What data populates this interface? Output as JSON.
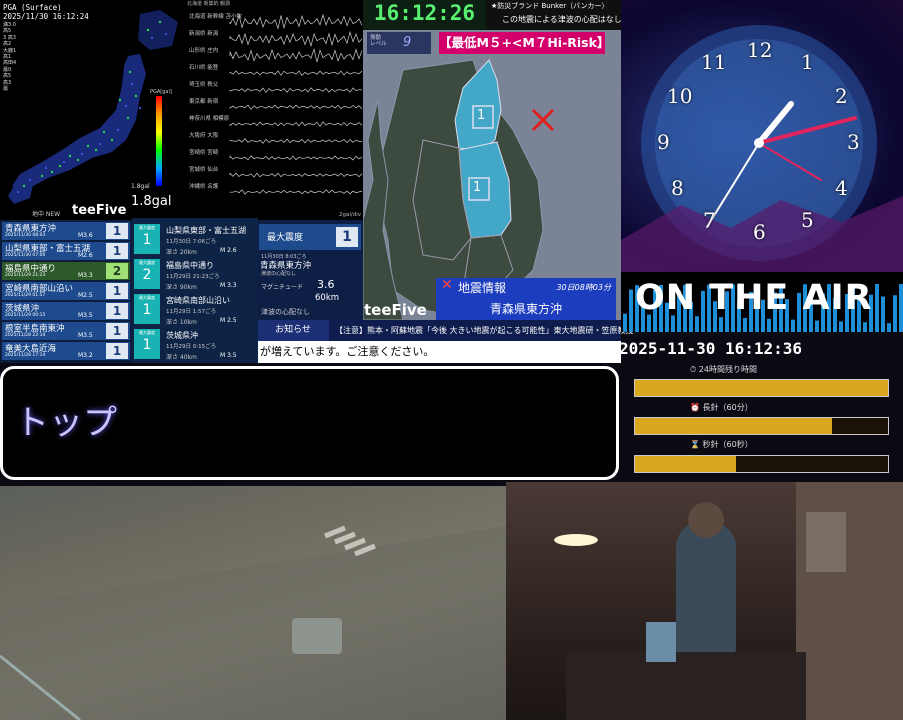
{
  "map_panel": {
    "title": "PGA (Surface)",
    "timestamp": "2025/11/30 16:12:24",
    "scale_labels": [
      "満3.0",
      "高5",
      "3 高3",
      "高2",
      "大鹿1",
      "高1",
      "高田4",
      "最0",
      "高5",
      "高3",
      "最"
    ],
    "unit_label": "PGA[gal]",
    "tick_labels": [
      "",
      "",
      "",
      "",
      "",
      "",
      "",
      ""
    ],
    "gal_small": "1.8gal",
    "gal_big": "1.8gal"
  },
  "wave_panel": {
    "header": "北海道 新築的 観測",
    "stations": [
      "北海道 新幹線 苫小牧",
      "新潟県 新潟",
      "山形県 庄内",
      "石川県 能登",
      "埼玉県 秩父",
      "東京都 新宿",
      "神奈川県 相模原",
      "大阪府 大阪",
      "宮崎県 宮崎",
      "宮城県 仙台",
      "沖縄県 名護"
    ],
    "footer": "2gal/div"
  },
  "clock_bar": {
    "time": "16:12:26"
  },
  "bunker": {
    "line1": "★防災ブランド Bunker（バンカー）",
    "line2": "この地震による津波の心配はなし"
  },
  "tohoku": {
    "level_label": "振動\nレベル",
    "level_value": "9",
    "risk_banner": "【最低M５+<M７Hi-Risk】",
    "intensity_top": "1",
    "intensity_mid": "1",
    "logo": "teeFive"
  },
  "quake_info": {
    "title": "地震情報",
    "time": "30日08時03分",
    "region": "青森県東方沖"
  },
  "notice": {
    "label": "お知らせ",
    "text": "【注意】熊本・阿蘇地震「今後 大きい地震が起こる可能性」東大地震研・笠原教授",
    "continued": "が増えています。ご注意ください。"
  },
  "quake_list": {
    "header": "地中 NEW",
    "logo": "teeFive",
    "rows": [
      {
        "name": "青森県東方沖",
        "date": "2025/11/30 08:03",
        "mag": "M3.6",
        "int": "1",
        "hl": false
      },
      {
        "name": "山梨県東部・富士五湖",
        "date": "2025/11/30 07:00",
        "mag": "M2.6",
        "int": "1",
        "hl": false
      },
      {
        "name": "福島県中通り",
        "date": "2025/11/29 21:23",
        "mag": "M3.3",
        "int": "2",
        "hl": true
      },
      {
        "name": "宮崎県南部山沿い",
        "date": "2025/11/29 01:57",
        "mag": "M2.5",
        "int": "1",
        "hl": false
      },
      {
        "name": "茨城県沖",
        "date": "2025/11/29 00:15",
        "mag": "M3.5",
        "int": "1",
        "hl": false
      },
      {
        "name": "根室半島南東沖",
        "date": "2025/11/28 22:14",
        "mag": "M3.5",
        "int": "1",
        "hl": false
      },
      {
        "name": "奄美大島近海",
        "date": "2025/11/28 17:14",
        "mag": "M3.2",
        "int": "1",
        "hl": false
      }
    ]
  },
  "detail_list": {
    "int_label": "最大震度",
    "rows": [
      {
        "name": "山梨県東部・富士五湖",
        "date": "11月30日 7:06ごろ",
        "depth": "深さ 20km",
        "mag": "M 2.6",
        "int": "1"
      },
      {
        "name": "福島県中通り",
        "date": "11月29日 21:23ごろ",
        "depth": "深さ 90km",
        "mag": "M 3.3",
        "int": "2"
      },
      {
        "name": "宮崎県南部山沿い",
        "date": "11月29日 1:57ごろ",
        "depth": "深さ 10km",
        "mag": "M 2.5",
        "int": "1"
      },
      {
        "name": "茨城県沖",
        "date": "11月29日 0:15ごろ",
        "depth": "深さ 40km",
        "mag": "M 3.5",
        "int": "1"
      }
    ]
  },
  "max_panel": {
    "label": "最大震度",
    "value": "1",
    "date": "11月30日 8:03ごろ",
    "region": "青森県東方沖",
    "sub": "津波の心配なし",
    "mag_label": "マグニチュード",
    "mag_value": "3.6",
    "depth_value": "60km",
    "tsunami": "津波の心配なし"
  },
  "space_clock": {
    "numbers": [
      "12",
      "1",
      "2",
      "3",
      "4",
      "5",
      "6",
      "7",
      "8",
      "9",
      "10",
      "11"
    ],
    "hour_hand_color": "#ffffff",
    "second_hand_color": "#e0245e"
  },
  "on_air": {
    "banner": "ON THE AIR",
    "datetime": "2025-11-30 16:12:36",
    "bars": [
      {
        "label": "24時間残り時間",
        "value": 1.0
      },
      {
        "label": "長針（60分）",
        "value": 0.78
      },
      {
        "label": "秒針（60秒）",
        "value": 0.4
      }
    ]
  },
  "message": {
    "text": "トップ"
  }
}
